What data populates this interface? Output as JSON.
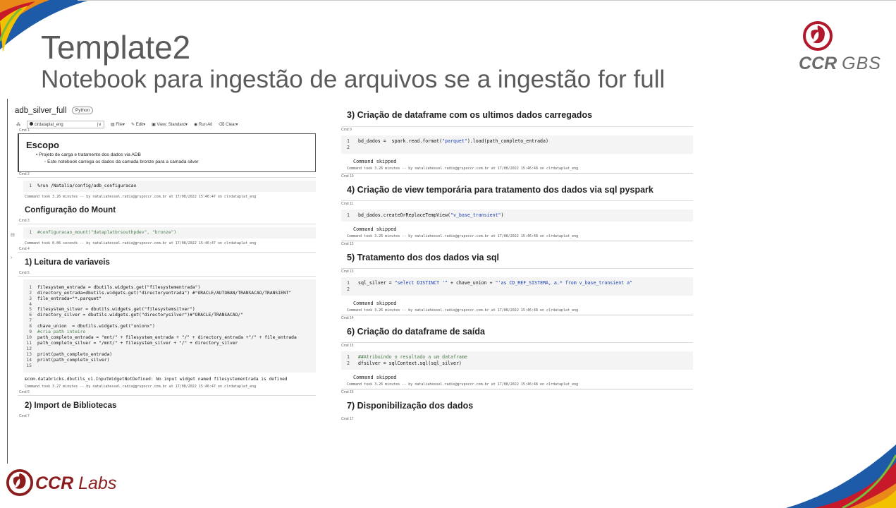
{
  "slide": {
    "title": "Template2",
    "subtitle": "Notebook para ingestão de arquivos se a ingestão for full"
  },
  "brand_top": {
    "ccr": "CCR",
    "gbs": "GBS"
  },
  "brand_bottom": {
    "ccr": "CCR",
    "labs": "Labs"
  },
  "colors": {
    "accent_red": "#b2182b",
    "brand_gray": "#6b6b6b",
    "labs_red": "#8b1d1d"
  },
  "notebook": {
    "name": "adb_silver_full",
    "language": "Python",
    "cluster": "clrdataplat_eng",
    "toolbar": {
      "file": "File",
      "edit": "Edit",
      "view": "View: Standard",
      "run_all": "Run All",
      "clear": "Clear"
    }
  },
  "left": {
    "cmd1": "Cmd 1",
    "escopo_title": "Escopo",
    "escopo_item": "Projeto de carga e tratamento dos dados via ADB",
    "escopo_subitem": "Este notebook carrega os dados da camada bronze para a camada silver",
    "cmd2": "Cmd 2",
    "run_code": "%run /Natalia/config/adb_configuracao",
    "run_status": "Command took 3.26 minutes -- by nataliahessel.radix@grupoccr.com.br at 17/08/2022 15:46:47 on clrdataplat_eng",
    "mount_title": "Configuração do Mount",
    "cmd3": "Cmd 3",
    "mount_code": "#configuracao_mount(\"dataplatbrsouthpdev\", \"bronze\")",
    "mount_status": "Command took 0.06 seconds -- by nataliahessel.radix@grupoccr.com.br at 17/08/2022 15:46:47 on clrdataplat_eng",
    "cmd4": "Cmd 4",
    "leitura_title": "1) Leitura de variaveis",
    "cmd5": "Cmd 5",
    "vars_code": [
      "filesystem_entrada = dbutils.widgets.get(\"filesystementrada\")",
      "directory_entrada=dbutils.widgets.get(\"directoryentrada\") #\"ORACLE/AUTOBAN/TRANSACAO/TRANSIENT\"",
      "file_entrada=\"*.parquet\"",
      "",
      "filesystem_silver = dbutils.widgets.get(\"filesystemsilver\")",
      "directory_silver = dbutils.widgets.get(\"directorysilver\")#\"ORACLE/TRANSACAO/\"",
      "",
      "chave_union  = dbutils.widgets.get(\"unionx\")",
      "#cria path inteiro",
      "path_completo_entrada = \"mnt/\" + filesystem_entrada + \"/\" + directory_entrada +\"/\" + file_entrada",
      "path_completo_silver = \"/mnt/\" + filesystem_silver + \"/\" + directory_silver",
      "",
      "print(path_completo_entrada)",
      "print(path_completo_silver)",
      ""
    ],
    "vars_error": "com.databricks.dbutils_v1.InputWidgetNotDefined: No input widget named filesystementrada is defined",
    "vars_status": "Command took 3.27 minutes -- by nataliahessel.radix@grupoccr.com.br at 17/08/2022 15:46:47 on clrdataplat_eng",
    "cmd6": "Cmd 6",
    "import_title": "2) Import de Bibliotecas",
    "cmd7": "Cmd 7"
  },
  "right": {
    "h3": "3) Criação de dataframe com os ultimos dados carregados",
    "cmd9": "Cmd 9",
    "code9": "bd_dados =  spark.read.format(\"parquet\").load(path_completo_entrada)",
    "skip9": "Command skipped",
    "status9": "Command took 3.26 minutes -- by nataliahessel.radix@grupoccr.com.br at 17/08/2022 15:46:48 on clrdataplat_eng",
    "cmd10": "Cmd 10",
    "h4": "4) Criação de view temporária para tratamento dos dados via sql pyspark",
    "cmd11": "Cmd 11",
    "code11": "bd_dados.createOrReplaceTempView(\"v_base_transient\")",
    "skip11": "Command skipped",
    "status11": "Command took 3.26 minutes -- by nataliahessel.radix@grupoccr.com.br at 17/08/2022 15:46:48 on clrdataplat_eng",
    "cmd12": "Cmd 12",
    "h5": "5) Tratamento dos dos dados via sql",
    "cmd13": "Cmd 13",
    "code13": "sql_silver = \"select DISTINCT '\" + chave_union + \"'as CD_REF_SISTEMA, a.* from v_base_transient a\"",
    "skip13": "Command skipped",
    "status13": "Command took 3.26 minutes -- by nataliahessel.radix@grupoccr.com.br at 17/08/2022 15:46:48 on clrdataplat_eng",
    "cmd14": "Cmd 14",
    "h6": "6) Criação do dataframe de saída",
    "cmd15": "Cmd 15",
    "code15a": "##Atribuindo o resultado a um dataframe",
    "code15b": "dfsilver = sqlContext.sql(sql_silver)",
    "skip15": "Command skipped",
    "status15": "Command took 3.26 minutes -- by nataliahessel.radix@grupoccr.com.br at 17/08/2022 15:46:48 on clrdataplat_eng",
    "cmd16": "Cmd 16",
    "h7": "7) Disponibilização dos dados",
    "cmd17": "Cmd 17"
  }
}
